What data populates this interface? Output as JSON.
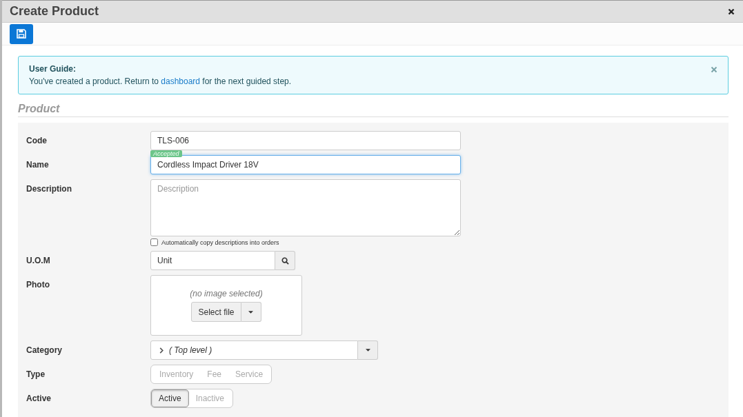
{
  "window": {
    "title": "Create Product"
  },
  "guide": {
    "title": "User Guide:",
    "text_before": "You've created a product. Return to",
    "link": "dashboard",
    "text_after": "for the next guided step."
  },
  "section": {
    "title": "Product"
  },
  "fields": [
    {
      "kind": "text",
      "label": "Code",
      "value": "TLS-006",
      "focused": false
    },
    {
      "kind": "text",
      "label": "Name",
      "value": "Cordless Impact Driver 18V",
      "focused": true,
      "badge": "Accepted"
    },
    {
      "kind": "textarea",
      "label": "Description",
      "placeholder": "Description",
      "checkbox": {
        "label": "Automatically copy descriptions into orders",
        "checked": false
      }
    },
    {
      "kind": "lookup",
      "label": "U.O.M",
      "value": "Unit"
    },
    {
      "kind": "photo",
      "label": "Photo",
      "empty_text": "(no image selected)",
      "button": "Select file"
    },
    {
      "kind": "tree",
      "label": "Category",
      "value": "( Top level )"
    },
    {
      "kind": "segments",
      "label": "Type",
      "options": [
        {
          "label": "Inventory",
          "selected": false
        },
        {
          "label": "Fee",
          "selected": false
        },
        {
          "label": "Service",
          "selected": false
        }
      ]
    },
    {
      "kind": "segments",
      "label": "Active",
      "options": [
        {
          "label": "Active",
          "selected": true
        },
        {
          "label": "Inactive",
          "selected": false
        }
      ]
    }
  ]
}
